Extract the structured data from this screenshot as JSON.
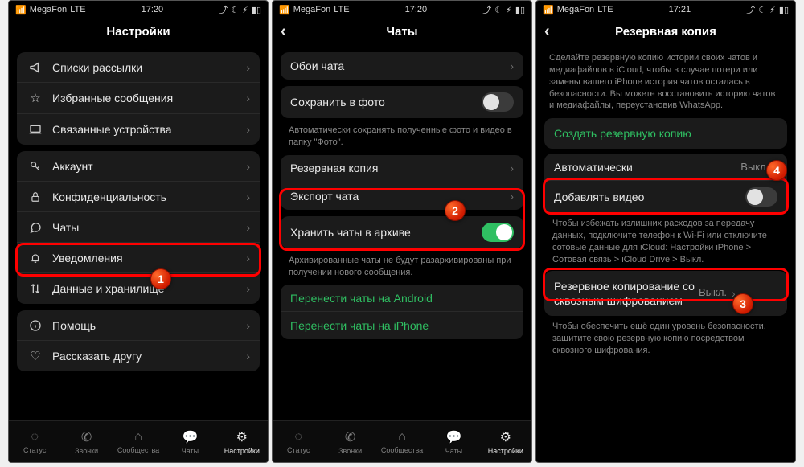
{
  "sb": {
    "carrier": "MegaFon",
    "net": "LTE",
    "t1": "17:20",
    "t2": "17:20",
    "t3": "17:21"
  },
  "p1": {
    "title": "Настройки",
    "g1": [
      {
        "icon": "📢",
        "label": "Списки рассылки"
      },
      {
        "icon": "☆",
        "label": "Избранные сообщения"
      },
      {
        "icon": "laptop",
        "label": "Связанные устройства"
      }
    ],
    "g2": [
      {
        "icon": "key",
        "label": "Аккаунт"
      },
      {
        "icon": "lock",
        "label": "Конфиденциальность"
      },
      {
        "icon": "bubble",
        "label": "Чаты"
      },
      {
        "icon": "bell",
        "label": "Уведомления"
      },
      {
        "icon": "updown",
        "label": "Данные и хранилище"
      }
    ],
    "g3": [
      {
        "icon": "info",
        "label": "Помощь"
      },
      {
        "icon": "heart",
        "label": "Рассказать другу"
      }
    ]
  },
  "p2": {
    "title": "Чаты",
    "wall": "Обои чата",
    "save": "Сохранить в фото",
    "saveCap": "Автоматически сохранять полученные фото и видео в папку \"Фото\".",
    "backup": "Резервная копия",
    "export": "Экспорт чата",
    "archive": "Хранить чаты в архиве",
    "archiveCap": "Архивированные чаты не будут разархивированы при получении нового сообщения.",
    "moveA": "Перенести чаты на Android",
    "moveI": "Перенести чаты на iPhone"
  },
  "p3": {
    "title": "Резервная копия",
    "intro": "Сделайте резервную копию истории своих чатов и медиафайлов в iCloud, чтобы в случае потери или замены вашего iPhone история чатов осталась в безопасности. Вы можете восстановить историю чатов и медиафайлы, переустановив WhatsApp.",
    "create": "Создать резервную копию",
    "auto": "Автоматически",
    "autoVal": "Выкл.",
    "video": "Добавлять видео",
    "videoCap": "Чтобы избежать излишних расходов за передачу данных, подключите телефон к Wi-Fi или отключите сотовые данные для iCloud: Настройки iPhone > Сотовая связь > iCloud Drive > Выкл.",
    "e2e": "Резервное копирование со сквозным шифрованием",
    "e2eVal": "Выкл.",
    "e2eCap": "Чтобы обеспечить ещё один уровень безопасности, защитите свою резервную копию посредством сквозного шифрования."
  },
  "tabs": [
    {
      "icon": "◌",
      "label": "Статус"
    },
    {
      "icon": "call",
      "label": "Звонки"
    },
    {
      "icon": "group",
      "label": "Сообщества"
    },
    {
      "icon": "chat",
      "label": "Чаты"
    },
    {
      "icon": "gear",
      "label": "Настройки"
    }
  ],
  "badges": {
    "b1": "1",
    "b2": "2",
    "b3": "3",
    "b4": "4"
  }
}
